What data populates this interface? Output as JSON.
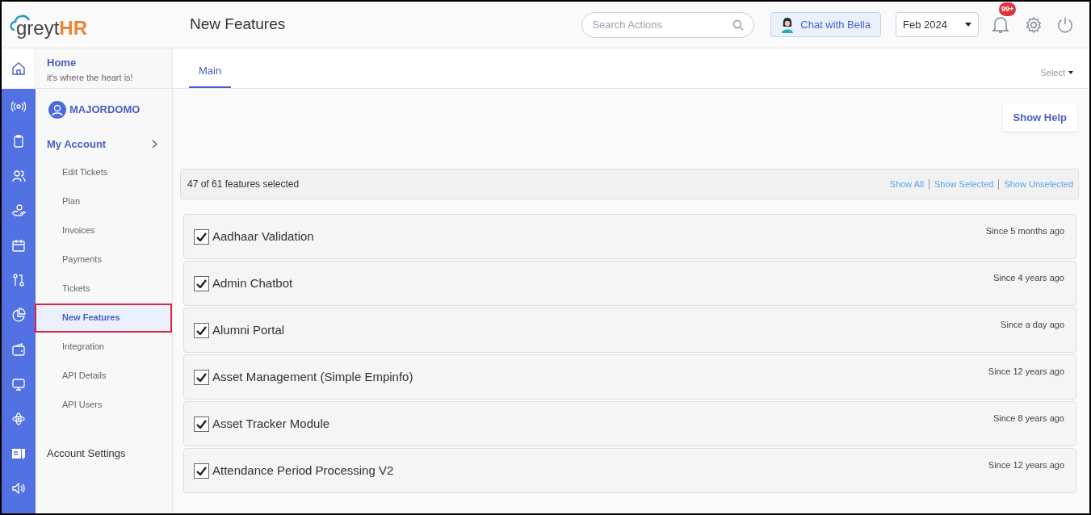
{
  "logo": {
    "text": "greyt",
    "accent": "HR"
  },
  "page_title": "New Features",
  "header": {
    "search": {
      "placeholder": "Search Actions"
    },
    "chat_button": "Chat with Bella",
    "period": "Feb 2024",
    "notification_badge": "99+"
  },
  "sidebar": {
    "home": {
      "title": "Home",
      "subtitle": "it's where the heart is!"
    },
    "user": "MAJORDOMO",
    "section": "My Account",
    "items": [
      {
        "label": "Edit Tickets",
        "selected": false
      },
      {
        "label": "Plan",
        "selected": false
      },
      {
        "label": "Invoices",
        "selected": false
      },
      {
        "label": "Payments",
        "selected": false
      },
      {
        "label": "Tickets",
        "selected": false
      },
      {
        "label": "New Features",
        "selected": true
      },
      {
        "label": "Integration",
        "selected": false
      },
      {
        "label": "API Details",
        "selected": false
      },
      {
        "label": "API Users",
        "selected": false
      }
    ],
    "footer_item": "Account Settings"
  },
  "tabs": [
    {
      "label": "Main",
      "selected": true
    }
  ],
  "select_dropdown": "Select",
  "help_button": "Show Help",
  "summary": "47 of 61 features selected",
  "filters": [
    "Show All",
    "Show Selected",
    "Show Unselected"
  ],
  "features": [
    {
      "name": "Aadhaar Validation",
      "since": "Since 5 months ago",
      "checked": true
    },
    {
      "name": "Admin Chatbot",
      "since": "Since 4 years ago",
      "checked": true
    },
    {
      "name": "Alumni Portal",
      "since": "Since a day ago",
      "checked": true
    },
    {
      "name": "Asset Management (Simple Empinfo)",
      "since": "Since 12 years ago",
      "checked": true
    },
    {
      "name": "Asset Tracker Module",
      "since": "Since 8 years ago",
      "checked": true
    },
    {
      "name": "Attendance Period Processing V2",
      "since": "Since 12 years ago",
      "checked": true
    }
  ]
}
